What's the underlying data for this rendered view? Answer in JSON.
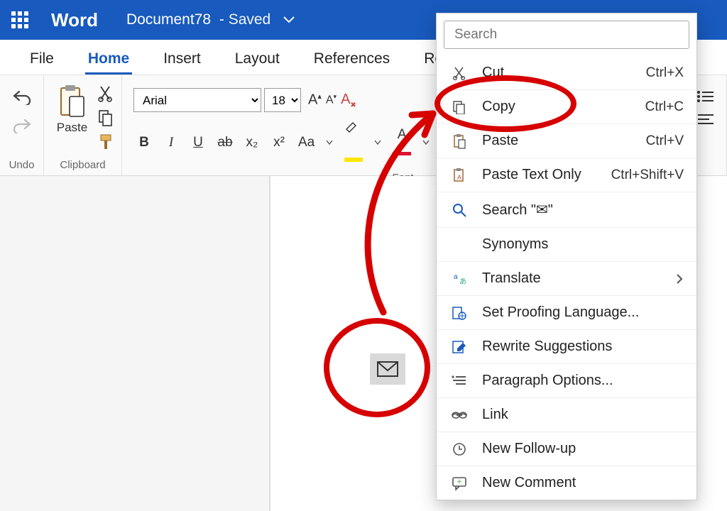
{
  "titlebar": {
    "app_name": "Word",
    "doc_name": "Document78",
    "status": " -  Saved"
  },
  "tabs": {
    "file": "File",
    "home": "Home",
    "insert": "Insert",
    "layout": "Layout",
    "references": "References",
    "review": "Review"
  },
  "ribbon": {
    "undo_label": "Undo",
    "clipboard_label": "Clipboard",
    "paste_label": "Paste",
    "font_label": "Font",
    "font_name": "Arial",
    "font_size": "18",
    "bold": "B",
    "italic": "I",
    "underline": "U",
    "strike": "ab",
    "subscript": "x₂",
    "superscript": "x²",
    "case": "Aa",
    "fontcolor_letter": "A"
  },
  "contextmenu": {
    "search_placeholder": "Search",
    "items": [
      {
        "label": "Cut",
        "shortcut": "Ctrl+X"
      },
      {
        "label": "Copy",
        "shortcut": "Ctrl+C"
      },
      {
        "label": "Paste",
        "shortcut": "Ctrl+V"
      },
      {
        "label": "Paste Text Only",
        "shortcut": "Ctrl+Shift+V"
      },
      {
        "label": "Search \"✉\"",
        "shortcut": ""
      },
      {
        "label": "Synonyms",
        "shortcut": ""
      },
      {
        "label": "Translate",
        "shortcut": "",
        "chevron": true
      },
      {
        "label": "Set Proofing Language...",
        "shortcut": ""
      },
      {
        "label": "Rewrite Suggestions",
        "shortcut": ""
      },
      {
        "label": "Paragraph Options...",
        "shortcut": ""
      },
      {
        "label": "Link",
        "shortcut": ""
      },
      {
        "label": "New Follow-up",
        "shortcut": ""
      },
      {
        "label": "New Comment",
        "shortcut": ""
      }
    ]
  }
}
